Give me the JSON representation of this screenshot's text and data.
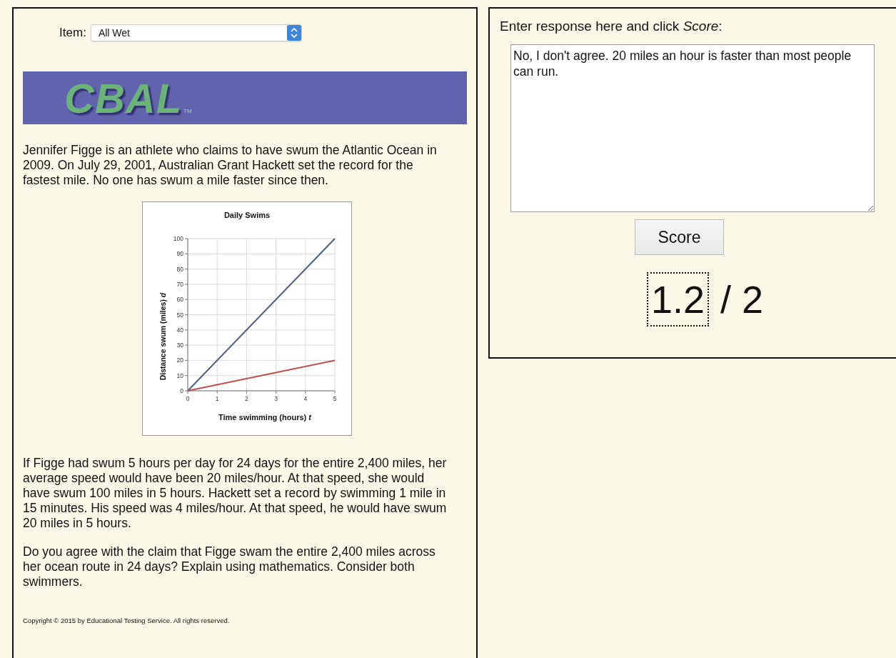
{
  "item_select": {
    "label": "Item:",
    "value": "All Wet"
  },
  "logo": {
    "text": "CBAL",
    "mark": "TM"
  },
  "intro": "Jennifer Figge is an athlete who claims to have swum the Atlantic Ocean in 2009. On July 29, 2001, Australian Grant Hackett set the record for the fastest mile. No one has swum a mile faster since then.",
  "chart": {
    "chart_data": {
      "type": "line",
      "grid": true,
      "title": "Daily Swims",
      "xlabel": "Time swimming (hours) *t*",
      "ylabel": "Distance swum (miles) *d*",
      "x": [
        0,
        5
      ],
      "xlim": [
        0,
        5
      ],
      "ylim": [
        0,
        100
      ],
      "xticks": [
        0,
        1,
        2,
        3,
        4,
        5
      ],
      "yticks": [
        0,
        10,
        20,
        30,
        40,
        50,
        60,
        70,
        80,
        90,
        100
      ],
      "series": [
        {
          "color": "#4a5f86",
          "values": [
            0,
            100
          ]
        },
        {
          "color": "#c0504d",
          "values": [
            0,
            20
          ]
        }
      ]
    }
  },
  "paragraphs": [
    "If Figge had swum 5 hours per day for 24 days for the entire 2,400 miles, her average speed would have been 20 miles/hour. At that speed, she would have swum 100 miles in 5 hours. Hackett set a record by swimming 1 mile in 15 minutes. His speed was 4 miles/hour. At that speed, he would have swum 20 miles in 5 hours.",
    "Do you agree with the claim that Figge swam the entire 2,400 miles across her ocean route in 24 days? Explain using mathematics. Consider both swimmers."
  ],
  "copyright": "Copyright © 2015 by Educational Testing Service. All rights reserved.",
  "response": {
    "instruction": "Enter response here and click *Score*:",
    "value": "No, I don't agree. 20 miles an hour is faster than most people can run.",
    "button": "Score",
    "score": "1.2",
    "max": "/ 2"
  }
}
